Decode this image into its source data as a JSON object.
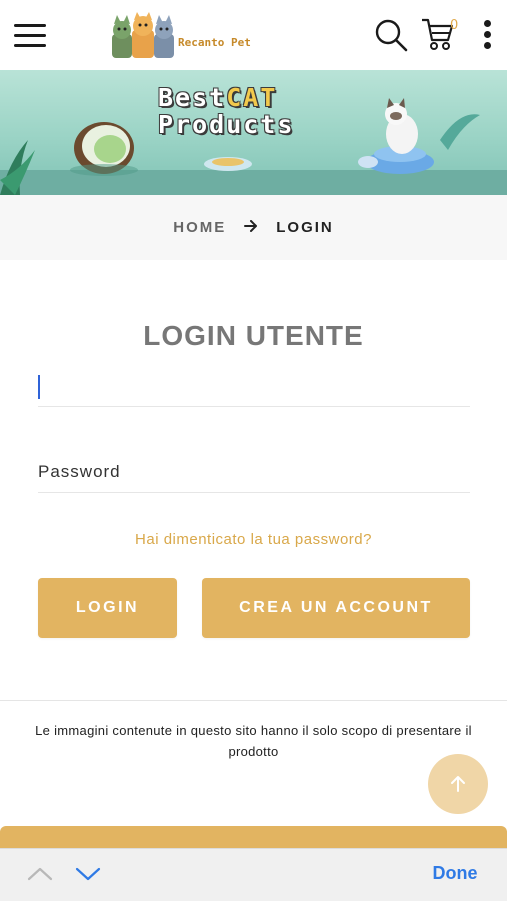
{
  "header": {
    "logo_text": "Recanto Pet",
    "cart_count": "0"
  },
  "banner": {
    "title_line1_a": "Best",
    "title_line1_b": "CAT",
    "title_line2": "Products"
  },
  "breadcrumb": {
    "home": "HOME",
    "current": "LOGIN"
  },
  "login": {
    "title": "LOGIN UTENTE",
    "email_value": "",
    "password_placeholder": "Password",
    "forgot_link": "Hai dimenticato la tua password?",
    "login_button": "LOGIN",
    "create_button": "CREA UN ACCOUNT"
  },
  "footer": {
    "disclaimer": "Le immagini contenute in questo sito hanno il solo scopo di presentare il prodotto"
  },
  "keyboard_bar": {
    "done": "Done"
  },
  "colors": {
    "accent": "#e2b461",
    "link": "#d9a84a",
    "ios_blue": "#2f7ae5"
  },
  "icons": [
    "hamburger-icon",
    "search-icon",
    "cart-icon",
    "kebab-icon",
    "arrow-right-icon",
    "arrow-up-icon",
    "chevron-up-icon",
    "chevron-down-icon"
  ]
}
